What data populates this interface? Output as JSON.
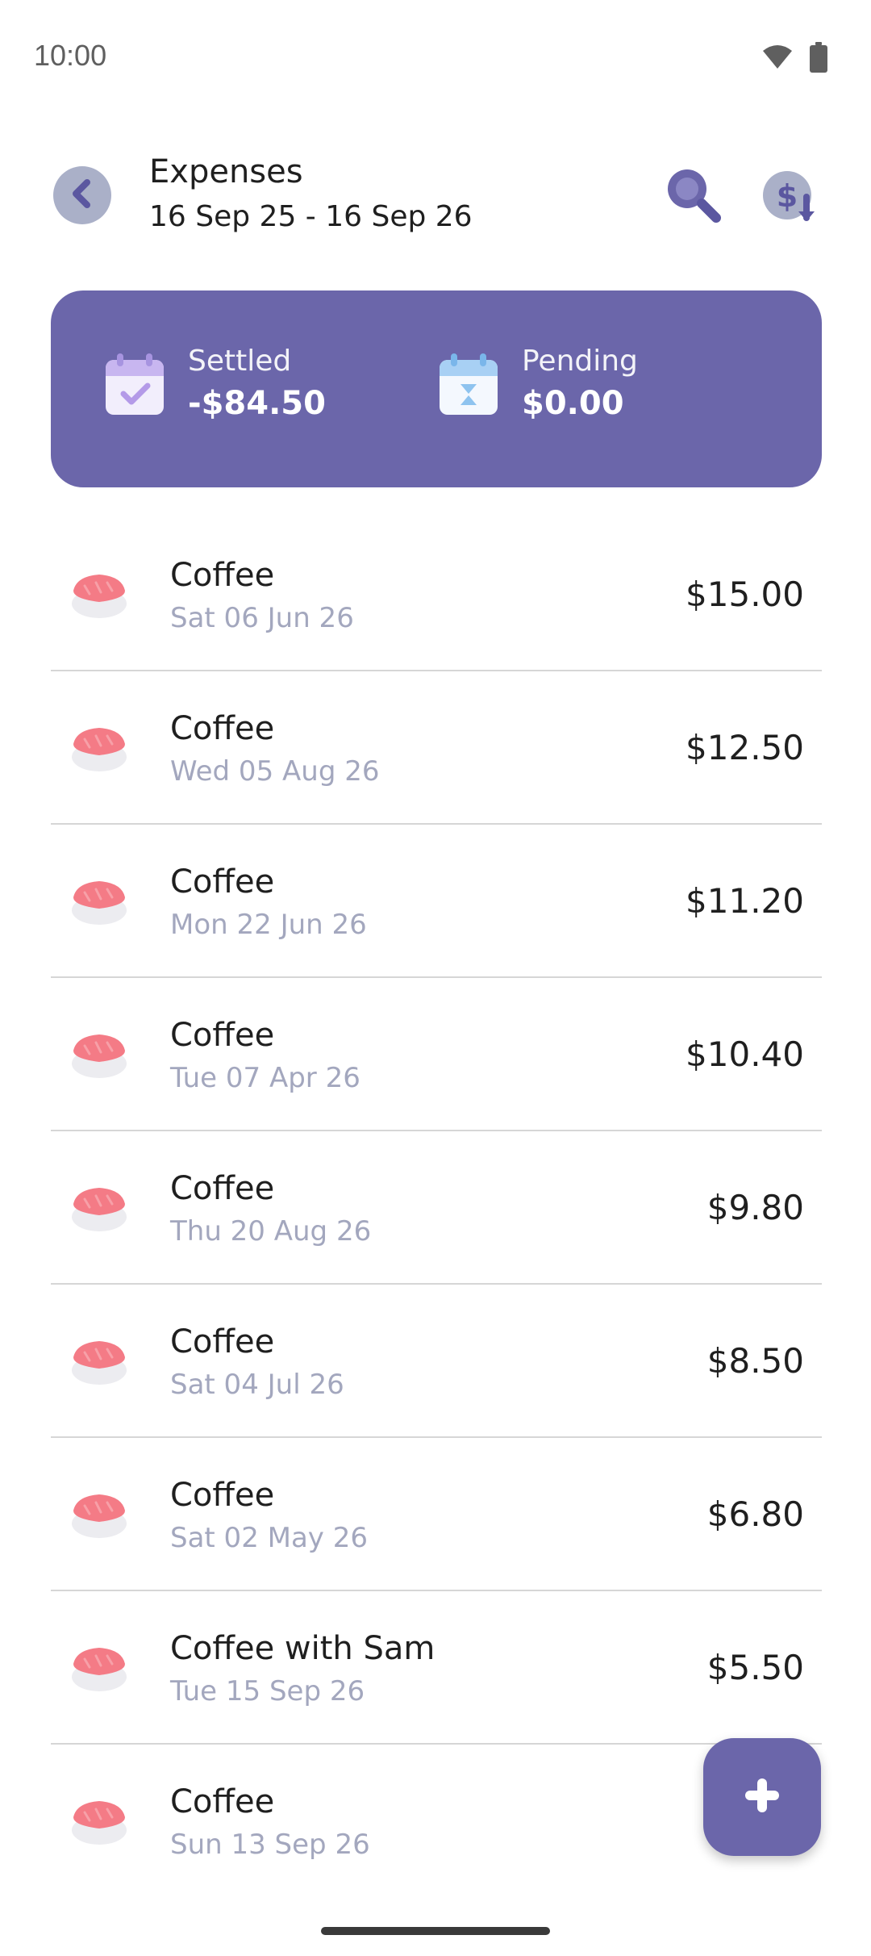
{
  "status_bar": {
    "time": "10:00",
    "icons": [
      "wifi-icon",
      "battery-icon"
    ]
  },
  "header": {
    "back_icon": "chevron-left-icon",
    "title": "Expenses",
    "date_range": "16 Sep 25 - 16 Sep 26",
    "search_icon": "search-icon",
    "export_icon": "dollar-download-icon"
  },
  "summary": {
    "settled_label": "Settled",
    "settled_value": "-$84.50",
    "pending_label": "Pending",
    "pending_value": "$0.00"
  },
  "expenses": [
    {
      "title": "Coffee",
      "date": "Sat 06 Jun 26",
      "amount": "$15.00"
    },
    {
      "title": "Coffee",
      "date": "Wed 05 Aug 26",
      "amount": "$12.50"
    },
    {
      "title": "Coffee",
      "date": "Mon 22 Jun 26",
      "amount": "$11.20"
    },
    {
      "title": "Coffee",
      "date": "Tue 07 Apr 26",
      "amount": "$10.40"
    },
    {
      "title": "Coffee",
      "date": "Thu 20 Aug 26",
      "amount": "$9.80"
    },
    {
      "title": "Coffee",
      "date": "Sat 04 Jul 26",
      "amount": "$8.50"
    },
    {
      "title": "Coffee",
      "date": "Sat 02 May 26",
      "amount": "$6.80"
    },
    {
      "title": "Coffee with Sam",
      "date": "Tue 15 Sep 26",
      "amount": "$5.50"
    },
    {
      "title": "Coffee",
      "date": "Sun 13 Sep 26",
      "amount": ""
    }
  ],
  "fab_icon": "plus-icon",
  "colors": {
    "accent": "#6b66aa",
    "date_text": "#a3a7be",
    "category_icon": "#f47b86"
  }
}
